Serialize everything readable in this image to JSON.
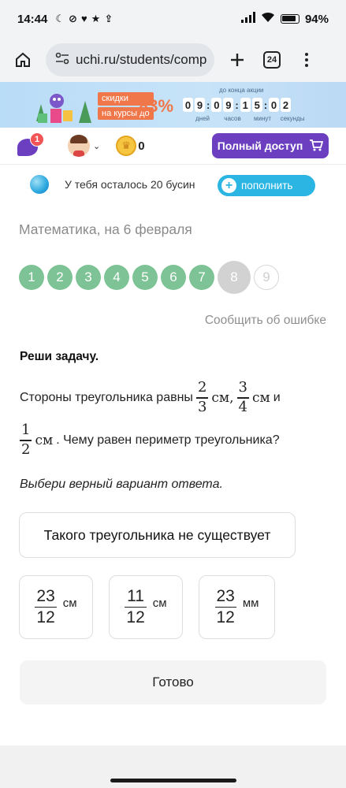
{
  "status_bar": {
    "time": "14:44",
    "left_icons": [
      "moon-icon",
      "mute-icon",
      "heart-icon",
      "star-icon",
      "upload-icon"
    ],
    "battery": "94",
    "battery_unit": "%"
  },
  "browser": {
    "url": "uchi.ru/students/comp",
    "tab_count": "24"
  },
  "promo": {
    "tag_top": "скидки",
    "tag_bottom": "на курсы до",
    "percent": "83%",
    "caption": "до конца акции",
    "countdown": [
      "0",
      "9",
      "0",
      "9",
      "1",
      "5",
      "0",
      "2"
    ],
    "labels": [
      "дней",
      "часов",
      "минут",
      "секунды"
    ]
  },
  "app_bar": {
    "chat_badge": "1",
    "coins": "0",
    "full_access_label": "Полный доступ"
  },
  "beads": {
    "text": "У тебя осталось 20 бусин",
    "top_up_label": "пополнить"
  },
  "subject": "Математика, на 6 февраля",
  "progress": {
    "done": [
      "1",
      "2",
      "3",
      "4",
      "5",
      "6",
      "7"
    ],
    "current": "8",
    "future": "9"
  },
  "report_label": "Сообщить об ошибке",
  "task": {
    "title": "Реши задачу.",
    "text_start": "Стороны треугольника равны",
    "f1": {
      "num": "2",
      "den": "3"
    },
    "unit1": "см,",
    "f2": {
      "num": "3",
      "den": "4"
    },
    "unit2": "см",
    "and": "и",
    "f3": {
      "num": "1",
      "den": "2"
    },
    "unit3": "см",
    "text_end": ". Чему равен периметр треугольника?"
  },
  "hint": "Выбери верный вариант ответа.",
  "options": {
    "wide": "Такого треугольника не существует",
    "o1": {
      "num": "23",
      "den": "12",
      "unit": "см"
    },
    "o2": {
      "num": "11",
      "den": "12",
      "unit": "см"
    },
    "o3": {
      "num": "23",
      "den": "12",
      "unit": "мм"
    }
  },
  "done_label": "Готово"
}
